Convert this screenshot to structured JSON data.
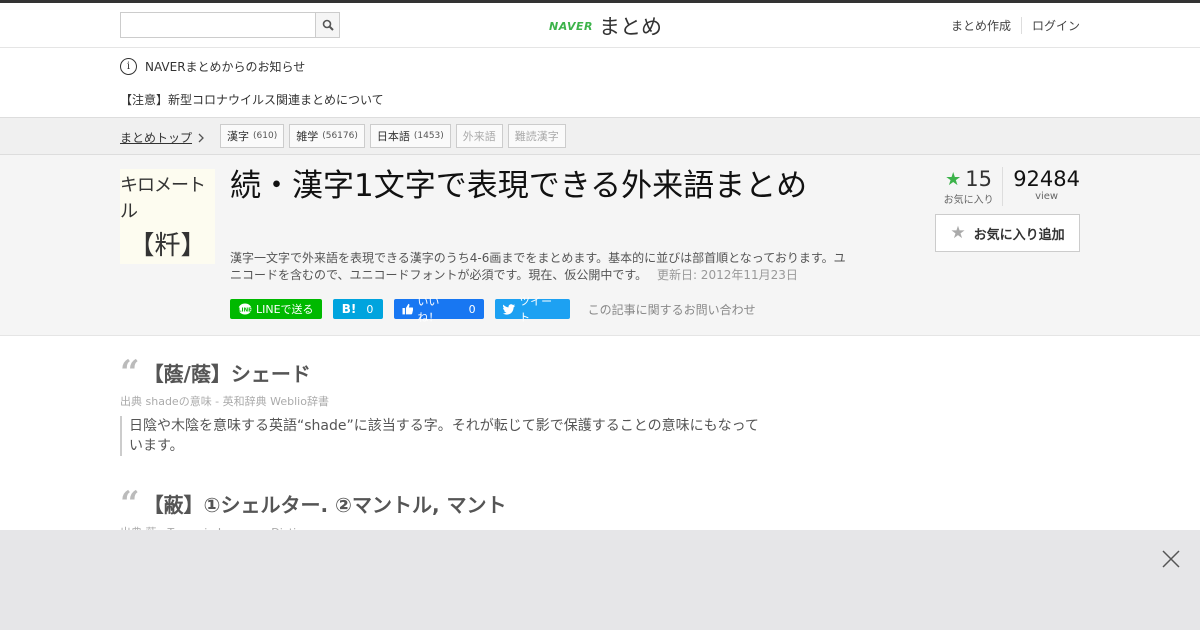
{
  "header": {
    "search_placeholder": "",
    "logo_naver": "NAVER",
    "logo_matome": "まとめ",
    "links": [
      "まとめ作成",
      "ログイン"
    ]
  },
  "notice": {
    "title": "NAVERまとめからのお知らせ",
    "message": "【注意】新型コロナウイルス関連まとめについて"
  },
  "breadcrumb": {
    "top": "まとめトップ",
    "tags": [
      {
        "label": "漢字",
        "count": "(610)"
      },
      {
        "label": "雑学",
        "count": "(56176)"
      },
      {
        "label": "日本語",
        "count": "(1453)"
      },
      {
        "label": "外来語",
        "count": ""
      },
      {
        "label": "難読漢字",
        "count": ""
      }
    ]
  },
  "article": {
    "thumb_line1": "キロメートル",
    "thumb_line2": "【粁】",
    "title": "続・漢字1文字で表現できる外来語まとめ",
    "description": "漢字一文字で外来語を表現できる漢字のうち4-6画までをまとめます。基本的に並びは部首順となっております。ユニコードを含むので、ユニコードフォントが必須です。現在、仮公開中です。",
    "updated": "更新日: 2012年11月23日",
    "favorites_count": "15",
    "favorites_label": "お気に入り",
    "views_count": "92484",
    "views_label": "view",
    "fav_button": "お気に入り追加"
  },
  "share": {
    "line": "LINEで送る",
    "hatena_count": "0",
    "fb_label": "いいね！",
    "fb_count": "0",
    "tweet": "ツイート",
    "inquiry": "この記事に関するお問い合わせ"
  },
  "items": [
    {
      "title": "【蔭/蔭】シェード",
      "source": "出典  shadeの意味 - 英和辞典 Weblio辞書",
      "body": "日陰や木陰を意味する英語“shade”に該当する字。それが転じて影で保護することの意味にもなっています。"
    },
    {
      "title": "【蔽】①シェルター. ②マントル, マント",
      "source": "出典  蔽 - Tangorin Japanese Dictionary",
      "body": ""
    }
  ],
  "icons": {
    "search": "search-icon",
    "info": "info-icon",
    "chevron": "chevron-right-icon",
    "star": "star-icon",
    "close": "close-icon"
  },
  "colors": {
    "accent_green": "#3cb34a",
    "line_green": "#00b900",
    "hatena_blue": "#00a4de",
    "facebook_blue": "#1877f2",
    "twitter_blue": "#1da1f2"
  }
}
